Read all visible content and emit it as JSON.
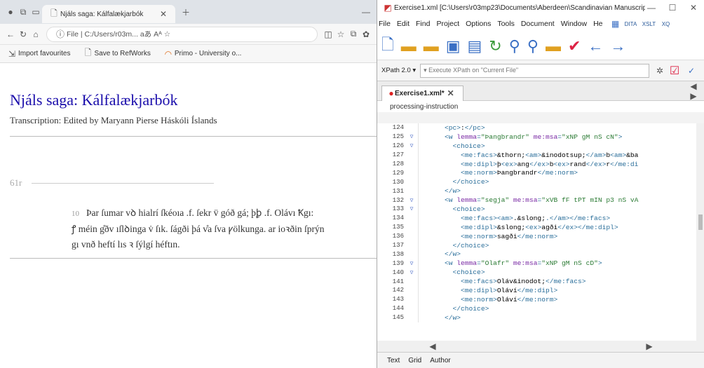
{
  "browser": {
    "tab_title": "Njáls saga: Kálfalækjarbók",
    "address": "File  |  C:/Users/r03m...  aあ  Aᴬ  ☆",
    "favourites": [
      "Import favourites",
      "Save to RefWorks",
      "Primo - University o..."
    ],
    "doc_title": "Njáls saga: Kálfalækjarbók",
    "doc_subtitle": "Transcription: Edited by Maryann Pierse Háskóli Íslands",
    "folio": "61r",
    "line_number": "10",
    "ms_lines": [
      "Þar ſumar vꝺ hialrí ſkéoıa .f. ſekr v̈ góð gá; þꝧ .f. Olávı Ꝁgı:",
      "ꝭ méin g̊ðv ıſlꝺinga v̇ ſık. ſágði þá v̊a ſva ꝩölkunga. ar ioꝛðin ſprýn",
      "gı vnð heftí lıs ꝛ ſýlgí héftın."
    ]
  },
  "editor": {
    "window_title": "Exercise1.xml [C:\\Users\\r03mp23\\Documents\\Aberdeen\\Scandinavian Manuscrip...",
    "menu": [
      "File",
      "Edit",
      "Find",
      "Project",
      "Options",
      "Tools",
      "Document",
      "Window",
      "He"
    ],
    "xpath_version": "XPath 2.0 ▾",
    "xpath_placeholder": "▾ Execute XPath on \"Current File\"",
    "tab_label": "Exercise1.xml*",
    "breadcrumb": "processing-instruction",
    "code_lines": [
      {
        "n": "124",
        "fold": "",
        "indent": "",
        "parts": [
          [
            "tag",
            "<pc>"
          ],
          [
            "txt",
            ":"
          ],
          [
            "tag",
            "</pc>"
          ]
        ]
      },
      {
        "n": "125",
        "fold": "▽",
        "indent": "",
        "parts": [
          [
            "tag",
            "<w "
          ],
          [
            "atn",
            "lemma"
          ],
          [
            "tag",
            "="
          ],
          [
            "atv",
            "\"Þangbrandr\""
          ],
          [
            "atn",
            " me:msa"
          ],
          [
            "tag",
            "="
          ],
          [
            "atv",
            "\"xNP gM nS cN\""
          ],
          [
            "tag",
            ">"
          ]
        ]
      },
      {
        "n": "126",
        "fold": "▽",
        "indent": "  ",
        "parts": [
          [
            "tag",
            "<choice>"
          ]
        ]
      },
      {
        "n": "127",
        "fold": "",
        "indent": "    ",
        "parts": [
          [
            "tag",
            "<me:facs>"
          ],
          [
            "txt",
            "&thorn;"
          ],
          [
            "tag",
            "<am>"
          ],
          [
            "txt",
            "&inodotsup;"
          ],
          [
            "tag",
            "</am>"
          ],
          [
            "txt",
            "b"
          ],
          [
            "tag",
            "<am>"
          ],
          [
            "txt",
            "&ba"
          ]
        ]
      },
      {
        "n": "128",
        "fold": "",
        "indent": "    ",
        "parts": [
          [
            "tag",
            "<me:dipl>"
          ],
          [
            "txt",
            "þ"
          ],
          [
            "tag",
            "<ex>"
          ],
          [
            "txt",
            "ang"
          ],
          [
            "tag",
            "</ex>"
          ],
          [
            "txt",
            "b"
          ],
          [
            "tag",
            "<ex>"
          ],
          [
            "txt",
            "rand"
          ],
          [
            "tag",
            "</ex>"
          ],
          [
            "txt",
            "r"
          ],
          [
            "tag",
            "</me:di"
          ]
        ]
      },
      {
        "n": "129",
        "fold": "",
        "indent": "    ",
        "parts": [
          [
            "tag",
            "<me:norm>"
          ],
          [
            "txt",
            "Þangbrandr"
          ],
          [
            "tag",
            "</me:norm>"
          ]
        ]
      },
      {
        "n": "130",
        "fold": "",
        "indent": "  ",
        "parts": [
          [
            "tag",
            "</choice>"
          ]
        ]
      },
      {
        "n": "131",
        "fold": "",
        "indent": "",
        "parts": [
          [
            "tag",
            "</w>"
          ]
        ]
      },
      {
        "n": "132",
        "fold": "▽",
        "indent": "",
        "parts": [
          [
            "tag",
            "<w "
          ],
          [
            "atn",
            "lemma"
          ],
          [
            "tag",
            "="
          ],
          [
            "atv",
            "\"segja\""
          ],
          [
            "atn",
            " me:msa"
          ],
          [
            "tag",
            "="
          ],
          [
            "atv",
            "\"xVB fF tPT mIN p3 nS vA"
          ]
        ]
      },
      {
        "n": "133",
        "fold": "▽",
        "indent": "  ",
        "parts": [
          [
            "tag",
            "<choice>"
          ]
        ]
      },
      {
        "n": "134",
        "fold": "",
        "indent": "    ",
        "parts": [
          [
            "tag",
            "<me:facs>"
          ],
          [
            "tag",
            "<am>"
          ],
          [
            "txt",
            ".&slong;"
          ],
          [
            "tag",
            "."
          ],
          [
            "tag",
            "</am>"
          ],
          [
            "tag",
            "</me:facs>"
          ]
        ]
      },
      {
        "n": "135",
        "fold": "",
        "indent": "    ",
        "parts": [
          [
            "tag",
            "<me:dipl>"
          ],
          [
            "txt",
            "&slong;"
          ],
          [
            "tag",
            "<ex>"
          ],
          [
            "txt",
            "agði"
          ],
          [
            "tag",
            "</ex>"
          ],
          [
            "tag",
            "</me:dipl>"
          ]
        ]
      },
      {
        "n": "136",
        "fold": "",
        "indent": "    ",
        "parts": [
          [
            "tag",
            "<me:norm>"
          ],
          [
            "txt",
            "sagði"
          ],
          [
            "tag",
            "</me:norm>"
          ]
        ]
      },
      {
        "n": "137",
        "fold": "",
        "indent": "  ",
        "parts": [
          [
            "tag",
            "</choice>"
          ]
        ]
      },
      {
        "n": "138",
        "fold": "",
        "indent": "",
        "parts": [
          [
            "tag",
            "</w>"
          ]
        ]
      },
      {
        "n": "139",
        "fold": "▽",
        "indent": "",
        "parts": [
          [
            "tag",
            "<w "
          ],
          [
            "atn",
            "lemma"
          ],
          [
            "tag",
            "="
          ],
          [
            "atv",
            "\"Olafr\""
          ],
          [
            "atn",
            " me:msa"
          ],
          [
            "tag",
            "="
          ],
          [
            "atv",
            "\"xNP gM nS cD\""
          ],
          [
            "tag",
            ">"
          ]
        ]
      },
      {
        "n": "140",
        "fold": "▽",
        "indent": "  ",
        "parts": [
          [
            "tag",
            "<choice>"
          ]
        ]
      },
      {
        "n": "141",
        "fold": "",
        "indent": "    ",
        "parts": [
          [
            "tag",
            "<me:facs>"
          ],
          [
            "txt",
            "Oláv&inodot;"
          ],
          [
            "tag",
            "</me:facs>"
          ]
        ]
      },
      {
        "n": "142",
        "fold": "",
        "indent": "    ",
        "parts": [
          [
            "tag",
            "<me:dipl>"
          ],
          [
            "txt",
            "Oláví"
          ],
          [
            "tag",
            "</me:dipl>"
          ]
        ]
      },
      {
        "n": "143",
        "fold": "",
        "indent": "    ",
        "parts": [
          [
            "tag",
            "<me:norm>"
          ],
          [
            "txt",
            "Oláví"
          ],
          [
            "tag",
            "</me:norm>"
          ]
        ]
      },
      {
        "n": "144",
        "fold": "",
        "indent": "  ",
        "parts": [
          [
            "tag",
            "</choice>"
          ]
        ]
      },
      {
        "n": "145",
        "fold": "",
        "indent": "",
        "parts": [
          [
            "tag",
            "</w>"
          ]
        ]
      }
    ],
    "modes": [
      "Text",
      "Grid",
      "Author"
    ]
  }
}
